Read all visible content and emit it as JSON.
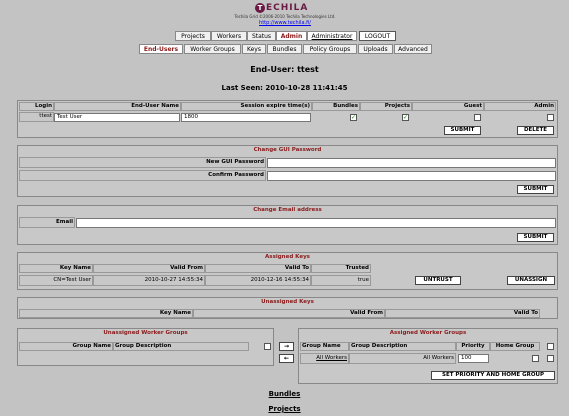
{
  "brand": {
    "logo_letter": "T",
    "logo_text": "ECHILA",
    "tagline": "Techila Grid ©2006-2010 Techila Technologies Ltd.",
    "url": "http://www.techila.fi/"
  },
  "nav": {
    "top": [
      "Projects",
      "Workers",
      "Status",
      "Admin",
      "Administrator",
      "LOGOUT"
    ],
    "sub": [
      "End-Users",
      "Worker Groups",
      "Keys",
      "Bundles",
      "Policy Groups",
      "Uploads",
      "Advanced"
    ]
  },
  "page": {
    "title": "End-User: ttest",
    "last_seen": "Last Seen: 2010-10-28 11:41:45"
  },
  "user_table": {
    "headers": [
      "Login",
      "End-User Name",
      "Session expire time(s)",
      "Bundles",
      "Projects",
      "Guest",
      "Admin"
    ],
    "login": "ttest",
    "name": "Test User",
    "expire": "1800",
    "bundles": "✓",
    "projects": "✓",
    "guest": "",
    "admin": "",
    "submit": "SUBMIT",
    "delete": "DELETE"
  },
  "change_pw": {
    "title": "Change GUI Password",
    "new_label": "New GUI Password",
    "confirm_label": "Confirm Password",
    "submit": "SUBMIT"
  },
  "change_email": {
    "title": "Change Email address",
    "email_label": "Email",
    "submit": "SUBMIT"
  },
  "assigned_keys": {
    "title": "Assigned Keys",
    "headers": [
      "Key Name",
      "Valid From",
      "Valid To",
      "Trusted"
    ],
    "row": {
      "key": "CN=Test User",
      "from": "2010-10-27 14:55:34",
      "to": "2010-12-16 14:55:34",
      "trusted": "true"
    },
    "untrust": "UNTRUST",
    "unassign": "UNASSIGN"
  },
  "unassigned_keys": {
    "title": "Unassigned Keys",
    "headers": [
      "Key Name",
      "Valid From",
      "Valid To"
    ]
  },
  "unassigned_groups": {
    "title": "Unassigned Worker Groups",
    "headers": [
      "Group Name",
      "Group Description"
    ]
  },
  "assigned_groups": {
    "title": "Assigned Worker Groups",
    "headers": [
      "Group Name",
      "Group Description",
      "Priority",
      "Home Group"
    ],
    "row": {
      "name": "All Workers",
      "desc": "All Workers",
      "priority": "100"
    },
    "button": "SET PRIORITY AND HOME GROUP"
  },
  "move": {
    "right": "→",
    "left": "←"
  },
  "links": {
    "bundles": "Bundles",
    "projects": "Projects"
  }
}
